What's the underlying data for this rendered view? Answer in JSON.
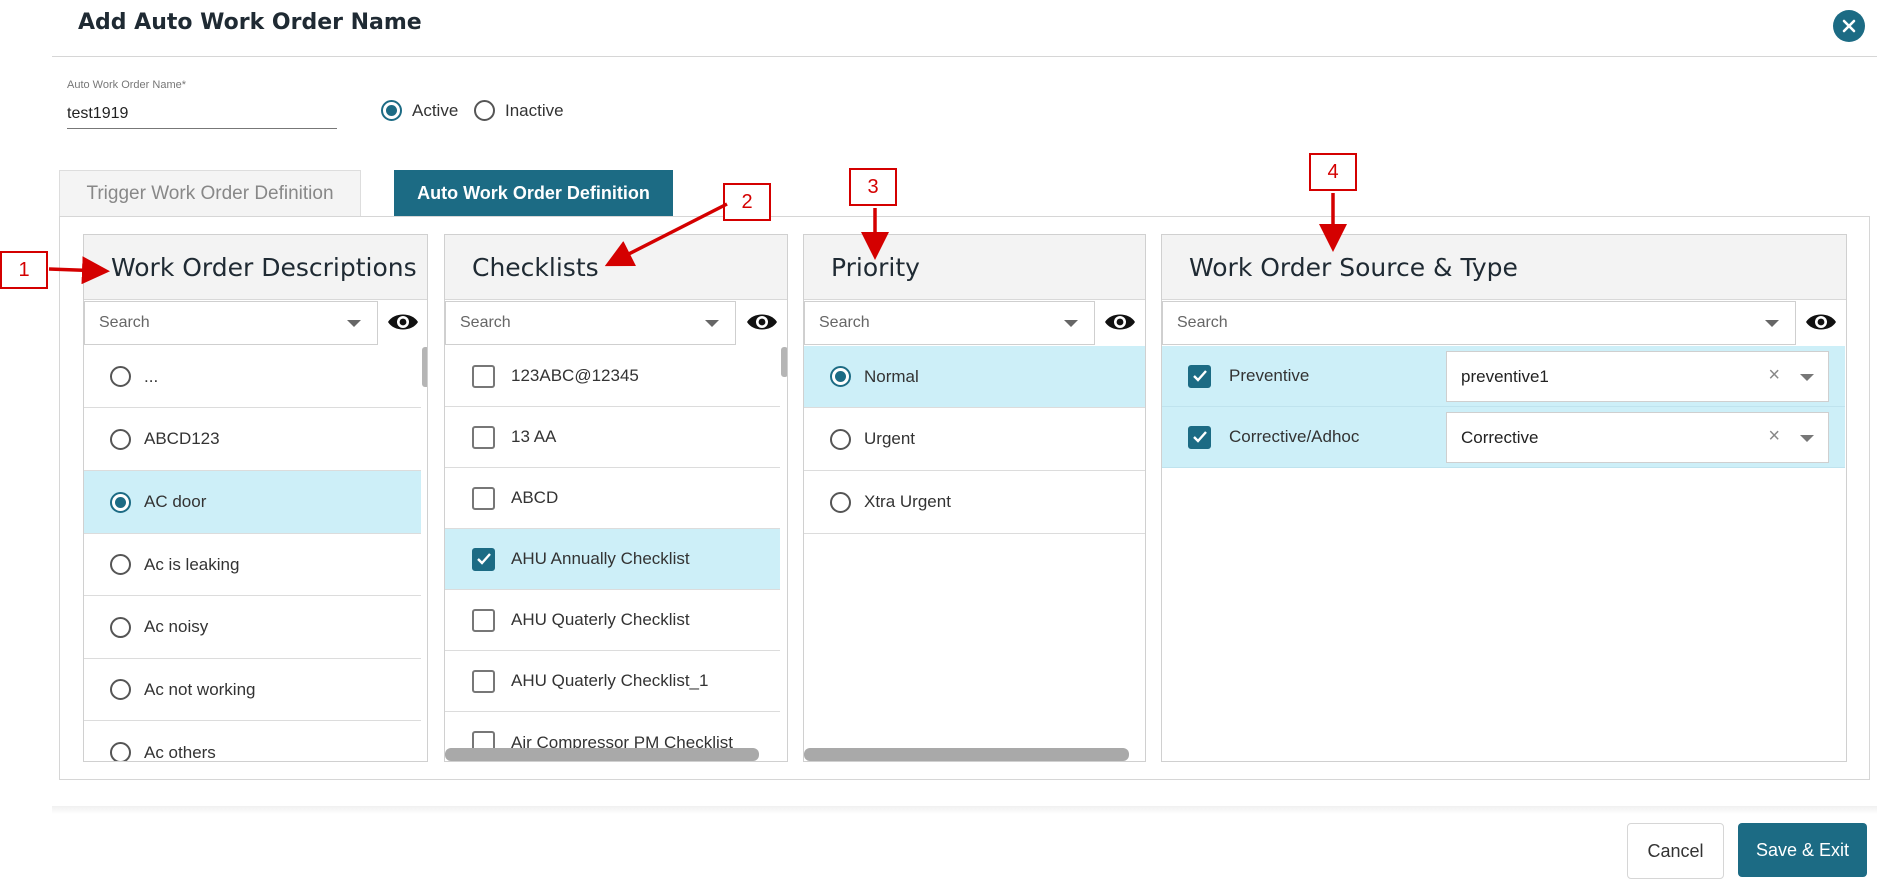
{
  "dialog": {
    "title": "Add Auto Work Order Name"
  },
  "name_field": {
    "label": "Auto Work Order Name*",
    "value": "test1919"
  },
  "status": {
    "options": [
      "Active",
      "Inactive"
    ],
    "selected": "Active"
  },
  "tabs": [
    {
      "label": "Trigger Work Order Definition",
      "active": false
    },
    {
      "label": "Auto Work Order Definition",
      "active": true
    }
  ],
  "columns": {
    "descriptions": {
      "title": "Work Order Descriptions",
      "search_placeholder": "Search",
      "items": [
        {
          "label": "...",
          "selected": false
        },
        {
          "label": "ABCD123",
          "selected": false
        },
        {
          "label": "AC door",
          "selected": true
        },
        {
          "label": "Ac is leaking",
          "selected": false
        },
        {
          "label": "Ac noisy",
          "selected": false
        },
        {
          "label": "Ac not working",
          "selected": false
        },
        {
          "label": "Ac others",
          "selected": false
        }
      ]
    },
    "checklists": {
      "title": "Checklists",
      "search_placeholder": "Search",
      "items": [
        {
          "label": "123ABC@12345",
          "checked": false
        },
        {
          "label": "13 AA",
          "checked": false
        },
        {
          "label": "ABCD",
          "checked": false
        },
        {
          "label": "AHU Annually Checklist",
          "checked": true
        },
        {
          "label": "AHU Quaterly Checklist",
          "checked": false
        },
        {
          "label": "AHU Quaterly Checklist_1",
          "checked": false
        },
        {
          "label": "Air Compressor PM Checklist",
          "checked": false
        }
      ]
    },
    "priority": {
      "title": "Priority",
      "search_placeholder": "Search",
      "items": [
        {
          "label": "Normal",
          "selected": true
        },
        {
          "label": "Urgent",
          "selected": false
        },
        {
          "label": "Xtra Urgent",
          "selected": false
        }
      ]
    },
    "source_type": {
      "title": "Work Order Source & Type",
      "search_placeholder": "Search",
      "items": [
        {
          "label": "Preventive",
          "checked": true,
          "type_value": "preventive1"
        },
        {
          "label": "Corrective/Adhoc",
          "checked": true,
          "type_value": "Corrective"
        }
      ]
    }
  },
  "annotations": [
    "1",
    "2",
    "3",
    "4"
  ],
  "footer": {
    "cancel_label": "Cancel",
    "save_label": "Save & Exit"
  },
  "colors": {
    "accent": "#1c6b84",
    "selected_row": "#cdeff8",
    "annotation": "#d40000"
  },
  "icons": {
    "close": "close-icon",
    "eye": "eye-icon",
    "dropdown": "chevron-down-icon",
    "clear": "clear-icon"
  }
}
